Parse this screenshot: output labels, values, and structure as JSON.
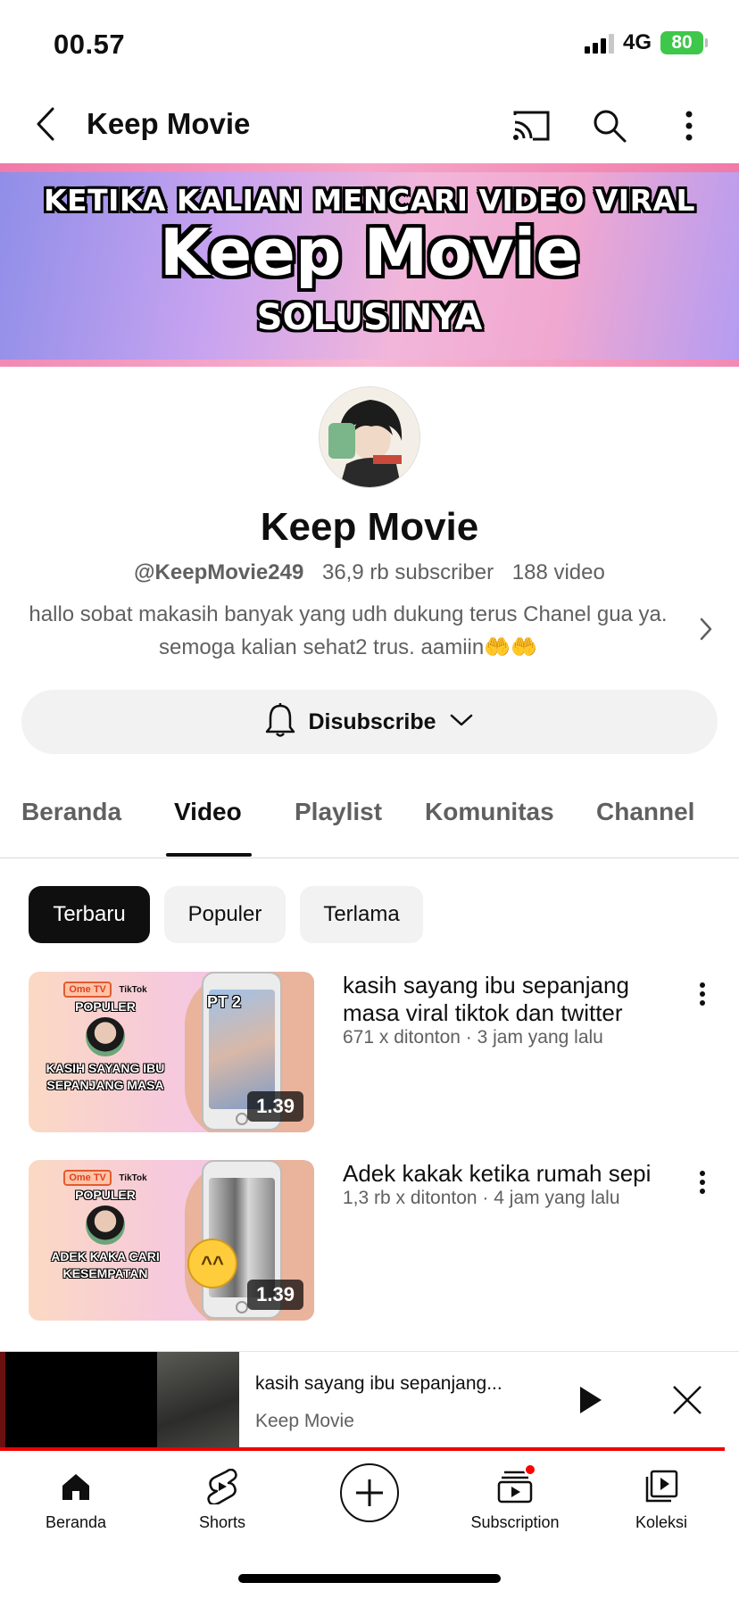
{
  "status_bar": {
    "time": "00.57",
    "network": "4G",
    "battery": "80"
  },
  "header": {
    "title": "Keep Movie",
    "icons": [
      "back-icon",
      "cast-icon",
      "search-icon",
      "more-vert-icon"
    ]
  },
  "banner": {
    "line1": "KETIKA KALIAN MENCARI VIDEO VIRAL",
    "line2": "Keep Movie",
    "line3": "SOLUSINYA"
  },
  "channel": {
    "name": "Keep Movie",
    "handle": "@KeepMovie249",
    "subscribers": "36,9 rb subscriber",
    "videos": "188 video",
    "description": "hallo sobat makasih banyak yang udh dukung terus Chanel gua ya. semoga kalian sehat2 trus. aamiin🤲🤲",
    "subscribe_label": "Disubscribe"
  },
  "tabs": [
    {
      "label": "Beranda"
    },
    {
      "label": "Video"
    },
    {
      "label": "Playlist"
    },
    {
      "label": "Komunitas"
    },
    {
      "label": "Channel"
    }
  ],
  "active_tab": "Video",
  "chips": [
    {
      "label": "Terbaru"
    },
    {
      "label": "Populer"
    },
    {
      "label": "Terlama"
    }
  ],
  "videos": [
    {
      "title": "kasih sayang ibu sepanjang masa viral tiktok dan twitter",
      "meta": "671 x ditonton · 3 jam yang lalu",
      "duration": "1.39",
      "thumb_badge": "Ome TV",
      "thumb_tiktok": "TikTok",
      "thumb_label": "POPULER",
      "thumb_caption": "KASIH SAYANG IBU SEPANJANG MASA",
      "thumb_overlay": "PT 2"
    },
    {
      "title": "Adek kakak ketika rumah sepi",
      "meta": "1,3 rb x ditonton · 4 jam yang lalu",
      "duration": "1.39",
      "thumb_badge": "Ome TV",
      "thumb_tiktok": "TikTok",
      "thumb_label": "POPULER",
      "thumb_caption": "ADEK KAKA CARI KESEMPATAN"
    }
  ],
  "mini_player": {
    "title": "kasih sayang ibu sepanjang...",
    "channel": "Keep Movie"
  },
  "bottom_nav": [
    {
      "label": "Beranda",
      "icon": "home-icon"
    },
    {
      "label": "Shorts",
      "icon": "shorts-icon"
    },
    {
      "label": "",
      "icon": "create-icon"
    },
    {
      "label": "Subscription",
      "icon": "subscriptions-icon"
    },
    {
      "label": "Koleksi",
      "icon": "library-icon"
    }
  ],
  "colors": {
    "accent": "#ff0000",
    "text": "#0f0f0f",
    "secondary": "#606060",
    "chip_bg": "#f2f2f2"
  }
}
